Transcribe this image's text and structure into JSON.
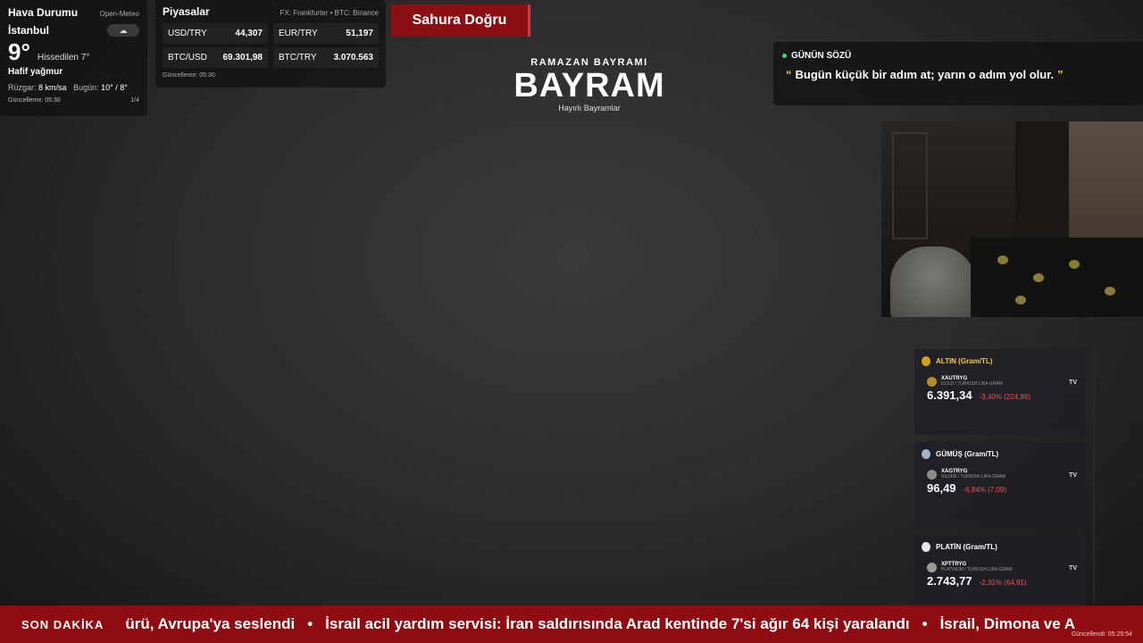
{
  "weather": {
    "title": "Hava Durumu",
    "source": "Open-Meteo",
    "city": "İstanbul",
    "icon": "cloud-rain-icon",
    "temp": "9°",
    "feels": "Hissedilen 7°",
    "condition": "Hafif yağmur",
    "wind_label": "Rüzgar:",
    "wind_value": "8 km/sa",
    "today_label": "Bugün:",
    "today_value": "10° / 8°",
    "updated": "Güncelleme: 05:30",
    "page": "1/4"
  },
  "markets": {
    "title": "Piyasalar",
    "source": "FX: Frankfurter • BTC: Binance",
    "items": [
      {
        "label": "USD/TRY",
        "value": "44,307"
      },
      {
        "label": "EUR/TRY",
        "value": "51,197"
      },
      {
        "label": "BTC/USD",
        "value": "69.301,98"
      },
      {
        "label": "BTC/TRY",
        "value": "3.070.563"
      }
    ],
    "updated": "Güncelleme: 05:30"
  },
  "sahur": {
    "label": "Sahura Doğru"
  },
  "bayram": {
    "subtitle": "RAMAZAN BAYRAMI",
    "title": "BAYRAM",
    "caption": "Hayırlı Bayramlar"
  },
  "quote": {
    "title": "GÜNÜN SÖZÜ",
    "open_mark": "“",
    "text": "Bugün küçük bir adım at; yarın o adım yol olur.",
    "close_mark": "”"
  },
  "metals": [
    {
      "title": "ALTIN (Gram/TL)",
      "symbol": "XAUTRYG",
      "description": "GOLD / TURKISH LIRA GRAM",
      "price": "6.391,34",
      "change": "-3,40% (224,88)",
      "color": "#d4a017",
      "icon": "gold-medal-icon"
    },
    {
      "title": "GÜMÜŞ (Gram/TL)",
      "symbol": "XAGTRYG",
      "description": "SILVER / TURKISH LIRA GRAM",
      "price": "96,49",
      "change": "-6,84% (7,09)",
      "color": "#9fb4c8",
      "icon": "silver-medal-icon"
    },
    {
      "title": "PLATİN (Gram/TL)",
      "symbol": "XPTTRYG",
      "description": "PLATINUM / TURKISH LIRA GRAM",
      "price": "2.743,77",
      "change": "-2,31% (64,91)",
      "color": "#e6e6e6",
      "icon": "platinum-circle-icon"
    }
  ],
  "tv_badge": "TV",
  "ticker": {
    "label": "SON DAKİKA",
    "items": [
      "ürü, Avrupa'ya seslendi",
      "İsrail acil yardım servisi: İran saldırısında Arad kentinde 7'si ağır 64 kişi yaralandı",
      "İsrail, Dimona ve A"
    ],
    "separator": "•",
    "updated": "Güncellendi: 05:29:54"
  },
  "colors": {
    "ticker_bg": "#8f0d12",
    "sahur_bg": "#8b0e14",
    "accent_gold": "#f2c94c",
    "negative": "#ef5350",
    "live_dot": "#52d273"
  }
}
